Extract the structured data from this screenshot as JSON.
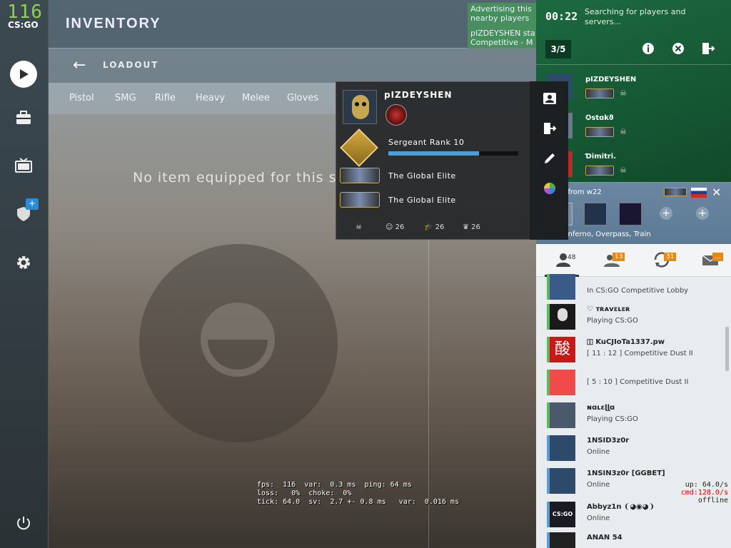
{
  "hud": {
    "fps": "116",
    "logo": "CS:GO"
  },
  "header": {
    "title": "INVENTORY",
    "subtitle": "LOADOUT"
  },
  "tabs": [
    "Pistol",
    "SMG",
    "Rifle",
    "Heavy",
    "Melee",
    "Gloves"
  ],
  "main": {
    "empty_message": "No item equipped for this slot"
  },
  "netgraph": {
    "line1": "fps:  116  var:  0.3 ms  ping: 64 ms",
    "line2": "loss:   0%  choke:  0%",
    "line3": "tick: 64.0  sv:  2.7 +- 0.8 ms   var:  0.016 ms"
  },
  "notifications": [
    {
      "text": "Advertising this",
      "text2": "nearby players"
    },
    {
      "text": "pIZDEYSHEN sta",
      "text2": "Competitive - M"
    }
  ],
  "lobby": {
    "timer": "00:22",
    "searching": "Searching for players and servers...",
    "count": "3/5",
    "members": [
      {
        "name": "pIZDEYSHEN"
      },
      {
        "name": "✪stɑkϑ"
      },
      {
        "name": "Ɗimitri."
      }
    ]
  },
  "invite": {
    "from": "e from w22",
    "maps": "etitive - Inferno, Overpass, Train"
  },
  "friends_tabs": [
    {
      "icon": "friends-icon",
      "badge": "48"
    },
    {
      "icon": "requests-icon",
      "badge": "13"
    },
    {
      "icon": "recent-icon",
      "badge": "31"
    },
    {
      "icon": "mail-icon",
      "badge": "..."
    }
  ],
  "friends": [
    {
      "name": "",
      "status": "In CS:GO Competitive Lobby",
      "bar": "#5cb85c",
      "avatar": "#3a5a8a"
    },
    {
      "name": "♡ ᴛʀᴀᴠᴇʟᴇʀ",
      "status": "Playing CS:GO",
      "bar": "#5cb85c",
      "avatar": "#1a1a1a"
    },
    {
      "name": "🇮 KuCJIoTa1337.pw",
      "status": "[ 11 : 12 ] Competitive Dust II",
      "bar": "#5cb85c",
      "avatar": "#c81818",
      "glyph": "酸"
    },
    {
      "name": "",
      "status": "[ 5 : 10 ] Competitive Dust II",
      "bar": "#5cb85c",
      "avatar": "#ef4b4b"
    },
    {
      "name": "ɴɑʟɛɭɭɑ",
      "status": "Playing CS:GO",
      "bar": "#5cb85c",
      "avatar": "#4a5a6a"
    },
    {
      "name": "1NSID3z0r",
      "status": "Online",
      "bar": "#5d9bd6",
      "avatar": "#2e4a6a"
    },
    {
      "name": "1NSIN3z0r [GGBET]",
      "status": "Online",
      "bar": "#5d9bd6",
      "avatar": "#2e4a6a"
    },
    {
      "name": "Abbyz1n ❨◕◉◕❩",
      "status": "Online",
      "bar": "#5d9bd6",
      "avatar": "#1a1a22",
      "glyph": "CS:GO"
    },
    {
      "name": "ANAN 54",
      "status": "",
      "bar": "#5d9bd6",
      "avatar": "#222"
    }
  ],
  "netinfo": {
    "up": "up: 64.0/s",
    "cmd": "cmd:128.0/s",
    "state": "offline"
  },
  "player_card": {
    "name": "pIZDEYSHEN",
    "rank_label": "Sergeant Rank 10",
    "xp_fraction": 0.7,
    "competitive_rank": "The Global Elite",
    "wingman_rank": "The Global Elite",
    "commends": {
      "friendly": "26",
      "teacher": "26",
      "leader": "26"
    }
  },
  "colors": {
    "lobby_green": "#1c6a40",
    "accent_blue": "#4c9ed9",
    "badge_orange": "#e08a1e"
  }
}
